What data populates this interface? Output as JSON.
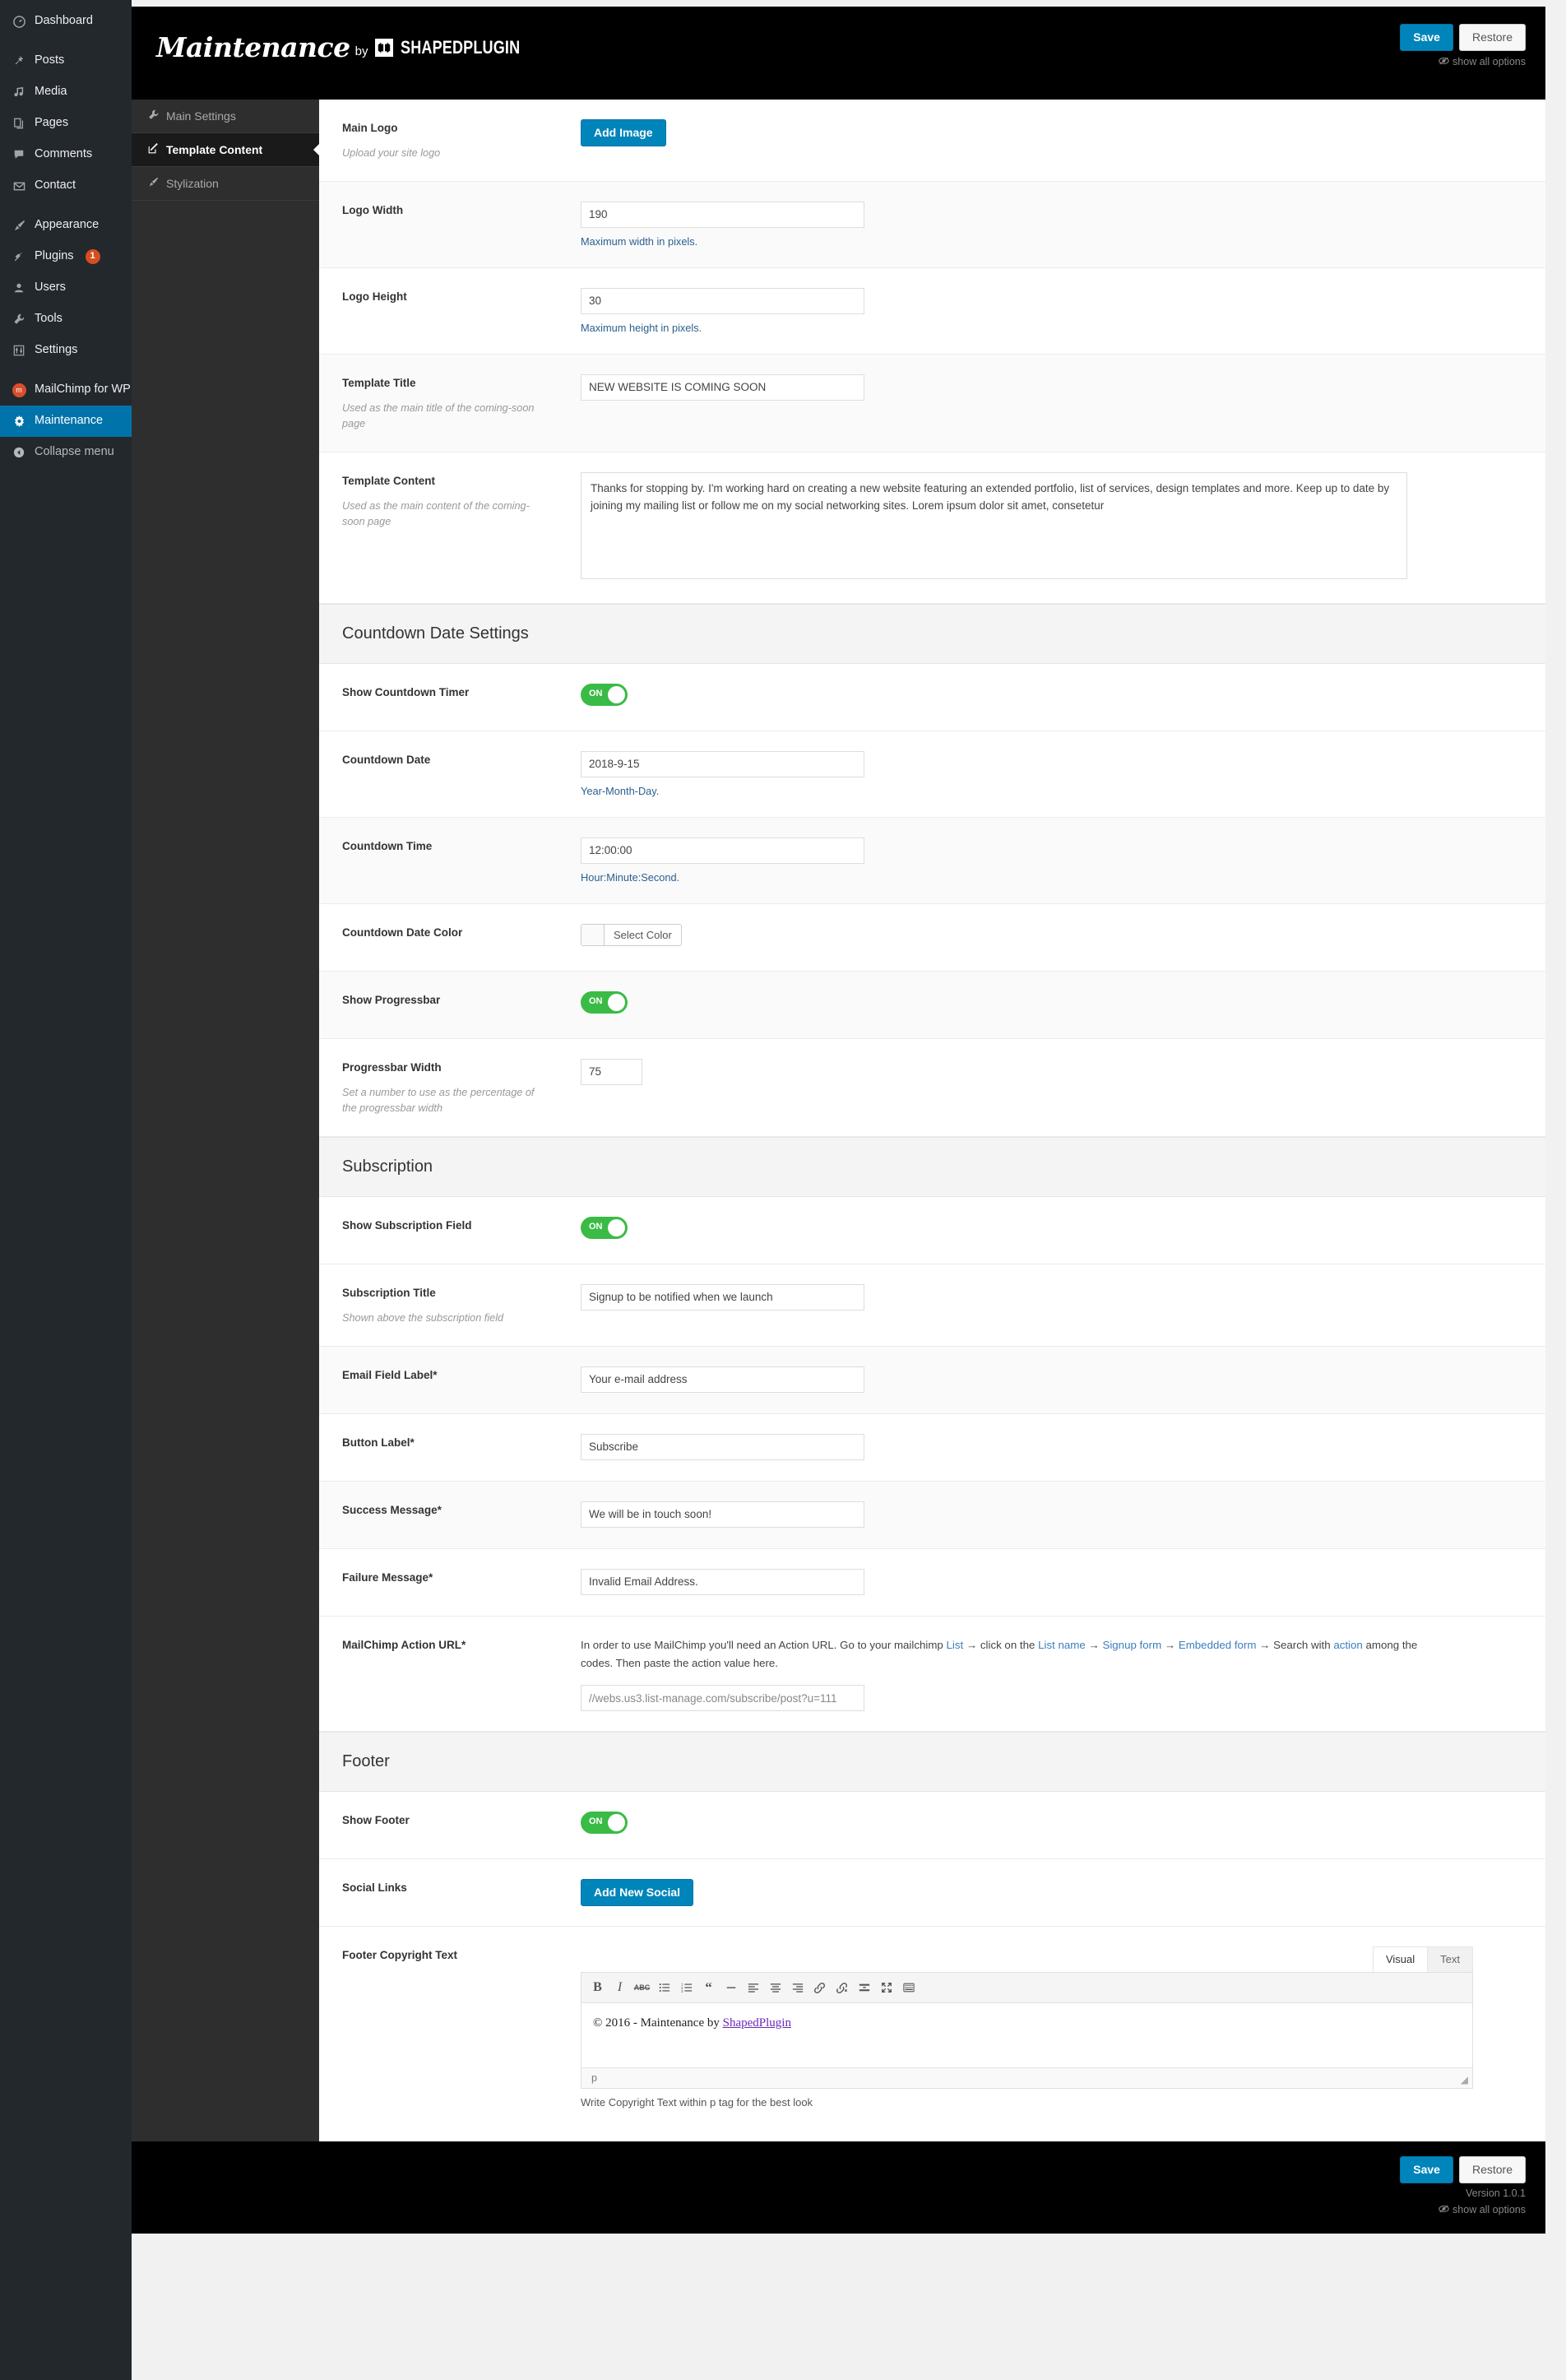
{
  "wp_sidebar": {
    "items": [
      {
        "label": "Dashboard",
        "icon": "dashboard-icon",
        "glyph": "◴",
        "badge": null,
        "current": false
      },
      {
        "label": "Posts",
        "icon": "pin-icon",
        "glyph": "✎",
        "badge": null,
        "current": false,
        "group_start": true
      },
      {
        "label": "Media",
        "icon": "media-icon",
        "glyph": "♫",
        "badge": null,
        "current": false
      },
      {
        "label": "Pages",
        "icon": "pages-icon",
        "glyph": "❐",
        "badge": null,
        "current": false
      },
      {
        "label": "Comments",
        "icon": "comments-icon",
        "glyph": "✦",
        "badge": null,
        "current": false
      },
      {
        "label": "Contact",
        "icon": "mail-icon",
        "glyph": "✉",
        "badge": null,
        "current": false
      },
      {
        "label": "Appearance",
        "icon": "brush-icon",
        "glyph": "✑",
        "badge": null,
        "current": false,
        "group_start": true
      },
      {
        "label": "Plugins",
        "icon": "plug-icon",
        "glyph": "⚯",
        "badge": "1",
        "current": false
      },
      {
        "label": "Users",
        "icon": "user-icon",
        "glyph": "☻",
        "badge": null,
        "current": false
      },
      {
        "label": "Tools",
        "icon": "wrench-icon",
        "glyph": "⚒",
        "badge": null,
        "current": false
      },
      {
        "label": "Settings",
        "icon": "sliders-icon",
        "glyph": "⚙",
        "badge": null,
        "current": false
      },
      {
        "label": "MailChimp for WP",
        "icon": "mailchimp-icon",
        "glyph": "m",
        "badge": null,
        "current": false,
        "group_start": true
      },
      {
        "label": "Maintenance",
        "icon": "gear-icon",
        "glyph": "✱",
        "badge": null,
        "current": true
      },
      {
        "label": "Collapse menu",
        "icon": "collapse-icon",
        "glyph": "◀",
        "badge": null,
        "current": false,
        "dim": true
      }
    ]
  },
  "header": {
    "brand_main": "Maintenance",
    "brand_by": "by",
    "brand_name": "SHAPEDPLUGIN",
    "save_label": "Save",
    "restore_label": "Restore",
    "show_all_label": "show all options"
  },
  "footer_bar": {
    "save_label": "Save",
    "restore_label": "Restore",
    "version": "Version 1.0.1",
    "show_all_label": "show all options"
  },
  "opt_nav": {
    "items": [
      {
        "label": "Main Settings",
        "icon": "wrench-icon",
        "glyph": "⚒",
        "active": false
      },
      {
        "label": "Template Content",
        "icon": "edit-square-icon",
        "glyph": "✎",
        "active": true
      },
      {
        "label": "Stylization",
        "icon": "paintbrush-icon",
        "glyph": "✒",
        "active": false
      }
    ]
  },
  "fields": {
    "main_logo": {
      "title": "Main Logo",
      "sub": "Upload your site logo",
      "button": "Add Image"
    },
    "logo_width": {
      "title": "Logo Width",
      "value": "190",
      "hint": "Maximum width in pixels."
    },
    "logo_height": {
      "title": "Logo Height",
      "value": "30",
      "hint": "Maximum height in pixels."
    },
    "template_title": {
      "title": "Template Title",
      "sub": "Used as the main title of the coming-soon page",
      "value": "NEW WEBSITE IS COMING SOON"
    },
    "template_content": {
      "title": "Template Content",
      "sub": "Used as the main content of the coming-soon page",
      "value": "Thanks for stopping by. I'm working hard on creating a new website featuring an extended portfolio, list of services, design templates and more. Keep up to date by joining my mailing list or follow me on my social networking sites. Lorem ipsum dolor sit amet, consetetur"
    },
    "show_countdown_timer": {
      "title": "Show Countdown Timer",
      "state": "ON"
    },
    "countdown_date": {
      "title": "Countdown Date",
      "value": "2018-9-15",
      "hint": "Year-Month-Day."
    },
    "countdown_time": {
      "title": "Countdown Time",
      "value": "12:00:00",
      "hint": "Hour:Minute:Second."
    },
    "countdown_date_color": {
      "title": "Countdown Date Color",
      "button": "Select Color"
    },
    "show_progressbar": {
      "title": "Show Progressbar",
      "state": "ON"
    },
    "progressbar_width": {
      "title": "Progressbar Width",
      "sub": "Set a number to use as the percentage of the progressbar width",
      "value": "75"
    },
    "show_subscription_field": {
      "title": "Show Subscription Field",
      "state": "ON"
    },
    "subscription_title": {
      "title": "Subscription Title",
      "sub": "Shown above the subscription field",
      "value": "Signup to be notified when we launch"
    },
    "email_field_label": {
      "title": "Email Field Label*",
      "value": "Your e-mail address"
    },
    "button_label": {
      "title": "Button Label*",
      "value": "Subscribe"
    },
    "success_message": {
      "title": "Success Message*",
      "value": "We will be in touch soon!"
    },
    "failure_message": {
      "title": "Failure Message*",
      "value": "Invalid Email Address."
    },
    "mailchimp_action_url": {
      "title": "MailChimp Action URL*",
      "help_1": "In order to use MailChimp you'll need an Action URL. Go to your mailchimp ",
      "link_list": "List",
      "help_2": " → click on the ",
      "link_list_name": "List name",
      "help_3": " → ",
      "link_signup_form": "Signup form",
      "help_4": " → ",
      "link_embedded_form": "Embedded form",
      "help_5": " → Search with ",
      "link_action": "action",
      "help_6": " among the codes. Then paste the action value here.",
      "value": "//webs.us3.list-manage.com/subscribe/post?u=111"
    },
    "show_footer": {
      "title": "Show Footer",
      "state": "ON"
    },
    "social_links": {
      "title": "Social Links",
      "button": "Add New Social"
    },
    "footer_copyright": {
      "title": "Footer Copyright Text",
      "tab_visual": "Visual",
      "tab_text": "Text",
      "content_prefix": "© 2016 - Maintenance by ",
      "content_link": "ShapedPlugin",
      "status_path": "p",
      "note": "Write Copyright Text within p tag for the best look"
    }
  },
  "sections": {
    "countdown": "Countdown Date Settings",
    "subscription": "Subscription",
    "footer": "Footer"
  },
  "editor_toolbar": [
    {
      "name": "bold-icon",
      "glyph": "B"
    },
    {
      "name": "italic-icon",
      "glyph": "I"
    },
    {
      "name": "strikethrough-icon",
      "glyph": "ABC"
    },
    {
      "name": "bullet-list-icon",
      "glyph": "☰"
    },
    {
      "name": "numbered-list-icon",
      "glyph": "☷"
    },
    {
      "name": "blockquote-icon",
      "glyph": "❝"
    },
    {
      "name": "horizontal-rule-icon",
      "glyph": "—"
    },
    {
      "name": "align-left-icon",
      "glyph": "≡"
    },
    {
      "name": "align-center-icon",
      "glyph": "≡"
    },
    {
      "name": "align-right-icon",
      "glyph": "≡"
    },
    {
      "name": "insert-link-icon",
      "glyph": "🔗"
    },
    {
      "name": "unlink-icon",
      "glyph": "⛓"
    },
    {
      "name": "read-more-icon",
      "glyph": "▤"
    },
    {
      "name": "fullscreen-icon",
      "glyph": "⤢"
    },
    {
      "name": "toolbar-toggle-icon",
      "glyph": "▦"
    }
  ],
  "colors": {
    "accent_blue": "#0085ba",
    "toggle_green": "#3abb45",
    "sidebar_dark": "#23282d",
    "nav_dark": "#2e2e2e",
    "badge_orange": "#d54e21",
    "link_blue": "#3d7dbd"
  }
}
